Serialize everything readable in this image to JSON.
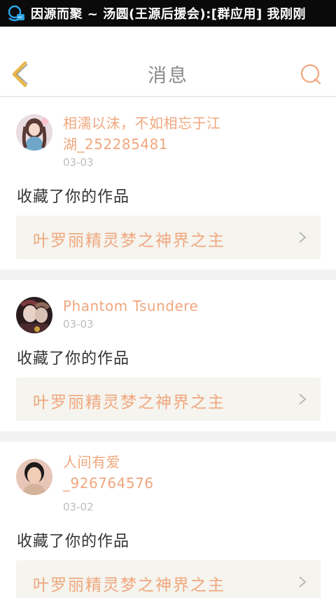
{
  "status_bar": {
    "ticker": "因源而聚 ~ 汤圆(王源后援会):[群应用] 我刚刚"
  },
  "header": {
    "title": "消息",
    "back_icon": "chevron-left-icon",
    "search_icon": "search-icon"
  },
  "colors": {
    "accent": "#f0a77e",
    "back_chevron": "#e8b64a",
    "card_link_bg": "#f5f4ee"
  },
  "messages": [
    {
      "user_name": "相濡以沫，不如相忘于江湖_252285481",
      "date": "03-03",
      "action": "收藏了你的作品",
      "work_title": "叶罗丽精灵梦之神界之主"
    },
    {
      "user_name": "Phantom Tsundere",
      "date": "03-03",
      "action": "收藏了你的作品",
      "work_title": "叶罗丽精灵梦之神界之主"
    },
    {
      "user_name": "人间有爱_926764576",
      "date": "03-02",
      "action": "收藏了你的作品",
      "work_title": "叶罗丽精灵梦之神界之主"
    }
  ]
}
